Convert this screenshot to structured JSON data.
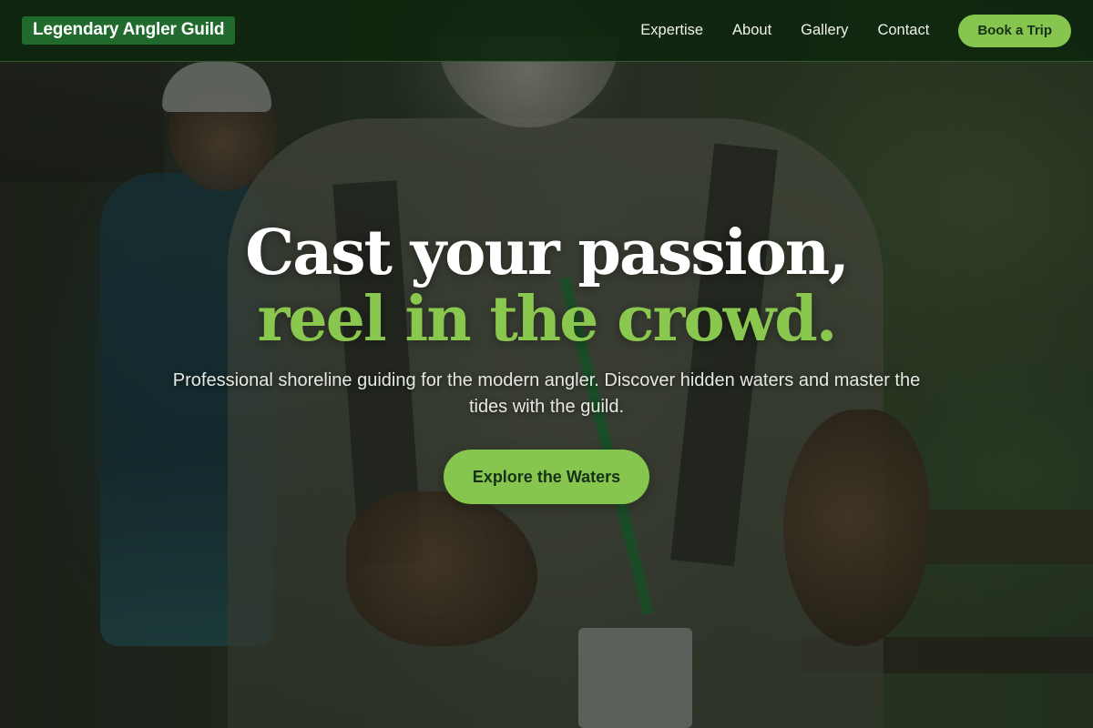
{
  "nav": {
    "brand": "Legendary Angler Guild",
    "links": [
      "Expertise",
      "About",
      "Gallery",
      "Contact"
    ],
    "cta_label": "Book a Trip"
  },
  "hero": {
    "headline_line1": "Cast your passion,",
    "headline_line2": "reel in the crowd.",
    "subtitle": "Professional shoreline guiding for the modern angler. Discover hidden waters and master the tides with the guild.",
    "cta_label": "Explore the Waters",
    "background_image": "Guide with lanyard and teen in cap on forest boardwalk"
  },
  "colors": {
    "accent_green": "#86c64e",
    "headline_green": "#8ac74f",
    "nav_background": "#0e260e",
    "brand_badge": "#1f6a2c"
  }
}
